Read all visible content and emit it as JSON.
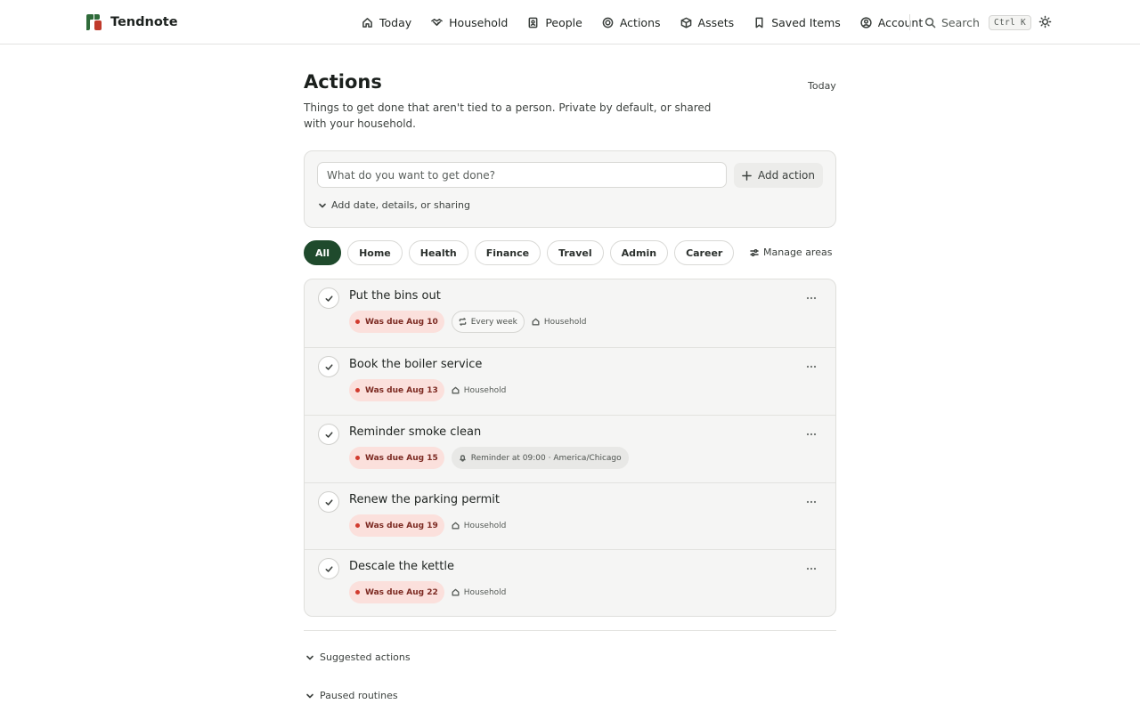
{
  "brand": {
    "name": "Tendnote",
    "icon": "tendnote-logo"
  },
  "nav": [
    {
      "label": "Today",
      "icon": "home-icon"
    },
    {
      "label": "Household",
      "icon": "handshake-icon"
    },
    {
      "label": "People",
      "icon": "contact-book-icon"
    },
    {
      "label": "Actions",
      "icon": "target-icon"
    },
    {
      "label": "Assets",
      "icon": "box-icon"
    },
    {
      "label": "Saved Items",
      "icon": "bookmark-icon"
    },
    {
      "label": "Account",
      "icon": "user-circle-icon"
    }
  ],
  "search": {
    "label": "Search",
    "shortcut": "Ctrl K",
    "icon": "search-icon"
  },
  "theme_toggle": {
    "icon": "sun-icon"
  },
  "page": {
    "title": "Actions",
    "subtitle": "Things to get done that aren't tied to a person. Private by default, or shared with your household.",
    "today_link": "Today"
  },
  "composer": {
    "placeholder": "What do you want to get done?",
    "add_label": "Add action",
    "details_label": "Add date, details, or sharing"
  },
  "filters": {
    "chips": [
      "All",
      "Home",
      "Health",
      "Finance",
      "Travel",
      "Admin",
      "Career"
    ],
    "active": "All",
    "manage_label": "Manage areas"
  },
  "actions": [
    {
      "title": "Put the bins out",
      "due": "Was due Aug 10",
      "pill": "Every week",
      "pill_icon": "repeat-icon",
      "tag": "Household"
    },
    {
      "title": "Book the boiler service",
      "due": "Was due Aug 13",
      "tag": "Household"
    },
    {
      "title": "Reminder smoke clean",
      "due": "Was due Aug 15",
      "pill": "Reminder at 09:00 · America/Chicago",
      "pill_icon": "bell-icon"
    },
    {
      "title": "Renew the parking permit",
      "due": "Was due Aug 19",
      "tag": "Household"
    },
    {
      "title": "Descale the kettle",
      "due": "Was due Aug 22",
      "tag": "Household"
    }
  ],
  "sections": {
    "suggested": "Suggested actions",
    "paused": "Paused routines"
  },
  "colors": {
    "accent": "#1f4a2c",
    "due_bg": "#fbe0dc",
    "due_dot": "#d23b2e",
    "due_text": "#7c2a22"
  }
}
